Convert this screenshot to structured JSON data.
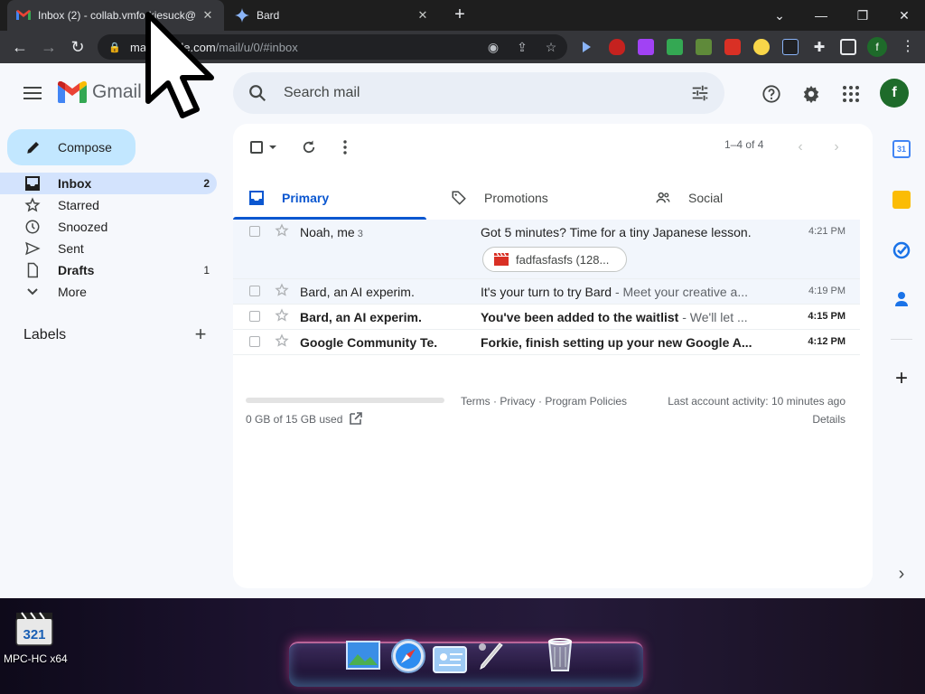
{
  "browser": {
    "tabs": [
      {
        "title": "Inbox (2) - collab.vmforkiesuck@",
        "close": "✕"
      },
      {
        "title": "Bard",
        "close": "✕"
      }
    ],
    "new_tab": "+",
    "window_controls": {
      "minimize": "—",
      "restore": "❐",
      "close": "✕",
      "tab_search": "⌄"
    },
    "url_host": "mail.google.com",
    "url_path": "/mail/u/0/#inbox",
    "profile_initial": "f"
  },
  "gmail": {
    "logo_text": "Gmail",
    "search_placeholder": "Search mail",
    "avatar_initial": "f",
    "compose_label": "Compose",
    "nav": [
      {
        "label": "Inbox",
        "count": "2",
        "icon": "inbox-icon"
      },
      {
        "label": "Starred",
        "count": "",
        "icon": "star-icon"
      },
      {
        "label": "Snoozed",
        "count": "",
        "icon": "clock-icon"
      },
      {
        "label": "Sent",
        "count": "",
        "icon": "send-icon"
      },
      {
        "label": "Drafts",
        "count": "1",
        "icon": "draft-icon"
      },
      {
        "label": "More",
        "count": "",
        "icon": "chevron-down-icon"
      }
    ],
    "labels_heading": "Labels",
    "pager": "1–4 of 4",
    "category_tabs": [
      {
        "label": "Primary",
        "icon": "inbox-icon"
      },
      {
        "label": "Promotions",
        "icon": "tag-icon"
      },
      {
        "label": "Social",
        "icon": "people-icon"
      }
    ],
    "emails": [
      {
        "sender": "Noah, me",
        "thread_count": "3",
        "subject": "Got 5 minutes? Time for a tiny Japanese lesson.",
        "snippet": "",
        "time": "4:21 PM",
        "attachment": "fadfasfasfs (128..."
      },
      {
        "sender": "Bard, an AI experim.",
        "thread_count": "",
        "subject": "It's your turn to try Bard",
        "snippet": " - Meet your creative a...",
        "time": "4:19 PM"
      },
      {
        "sender": "Bard, an AI experim.",
        "thread_count": "",
        "subject": "You've been added to the waitlist",
        "snippet": " - We'll let ...",
        "time": "4:15 PM"
      },
      {
        "sender": "Google Community Te.",
        "thread_count": "",
        "subject": "Forkie, finish setting up your new Google A...",
        "snippet": "",
        "time": "4:12 PM"
      }
    ],
    "footer": {
      "storage": "0 GB of 15 GB used",
      "policies": "Terms · Privacy · Program Policies",
      "activity": "Last account activity: 10 minutes ago",
      "details": "Details"
    },
    "side_panel": {
      "calendar_day": "31",
      "expand": "+",
      "collapse": "›"
    }
  },
  "desktop": {
    "icon_label": "MPC-HC x64",
    "icon_text": "321"
  },
  "colors": {
    "accent_blue": "#0b57d0",
    "compose_bg": "#c2e7ff",
    "active_nav_bg": "#d3e3fd",
    "avatar_green": "#1e6b2a",
    "gmail_bg": "#f6f8fc"
  }
}
